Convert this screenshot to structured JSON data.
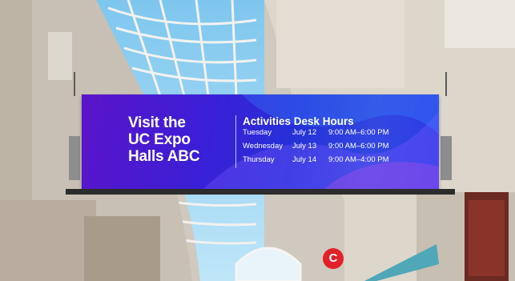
{
  "sign": {
    "visit_lines": [
      "Visit the",
      "UC Expo",
      "Halls ABC"
    ],
    "hours_title": "Activities Desk Hours",
    "schedule": [
      {
        "day": "Tuesday",
        "date": "July 12",
        "time": "9:00 AM–6:00 PM"
      },
      {
        "day": "Wednesday",
        "date": "July 13",
        "time": "9:00 AM–6:00 PM"
      },
      {
        "day": "Thursday",
        "date": "July 14",
        "time": "9:00 AM–4:00 PM"
      }
    ]
  },
  "badge": {
    "letter": "C"
  },
  "colors": {
    "screen": "#3a1fd6",
    "badge": "#e2202a",
    "skylight": "#8fd0f2"
  }
}
